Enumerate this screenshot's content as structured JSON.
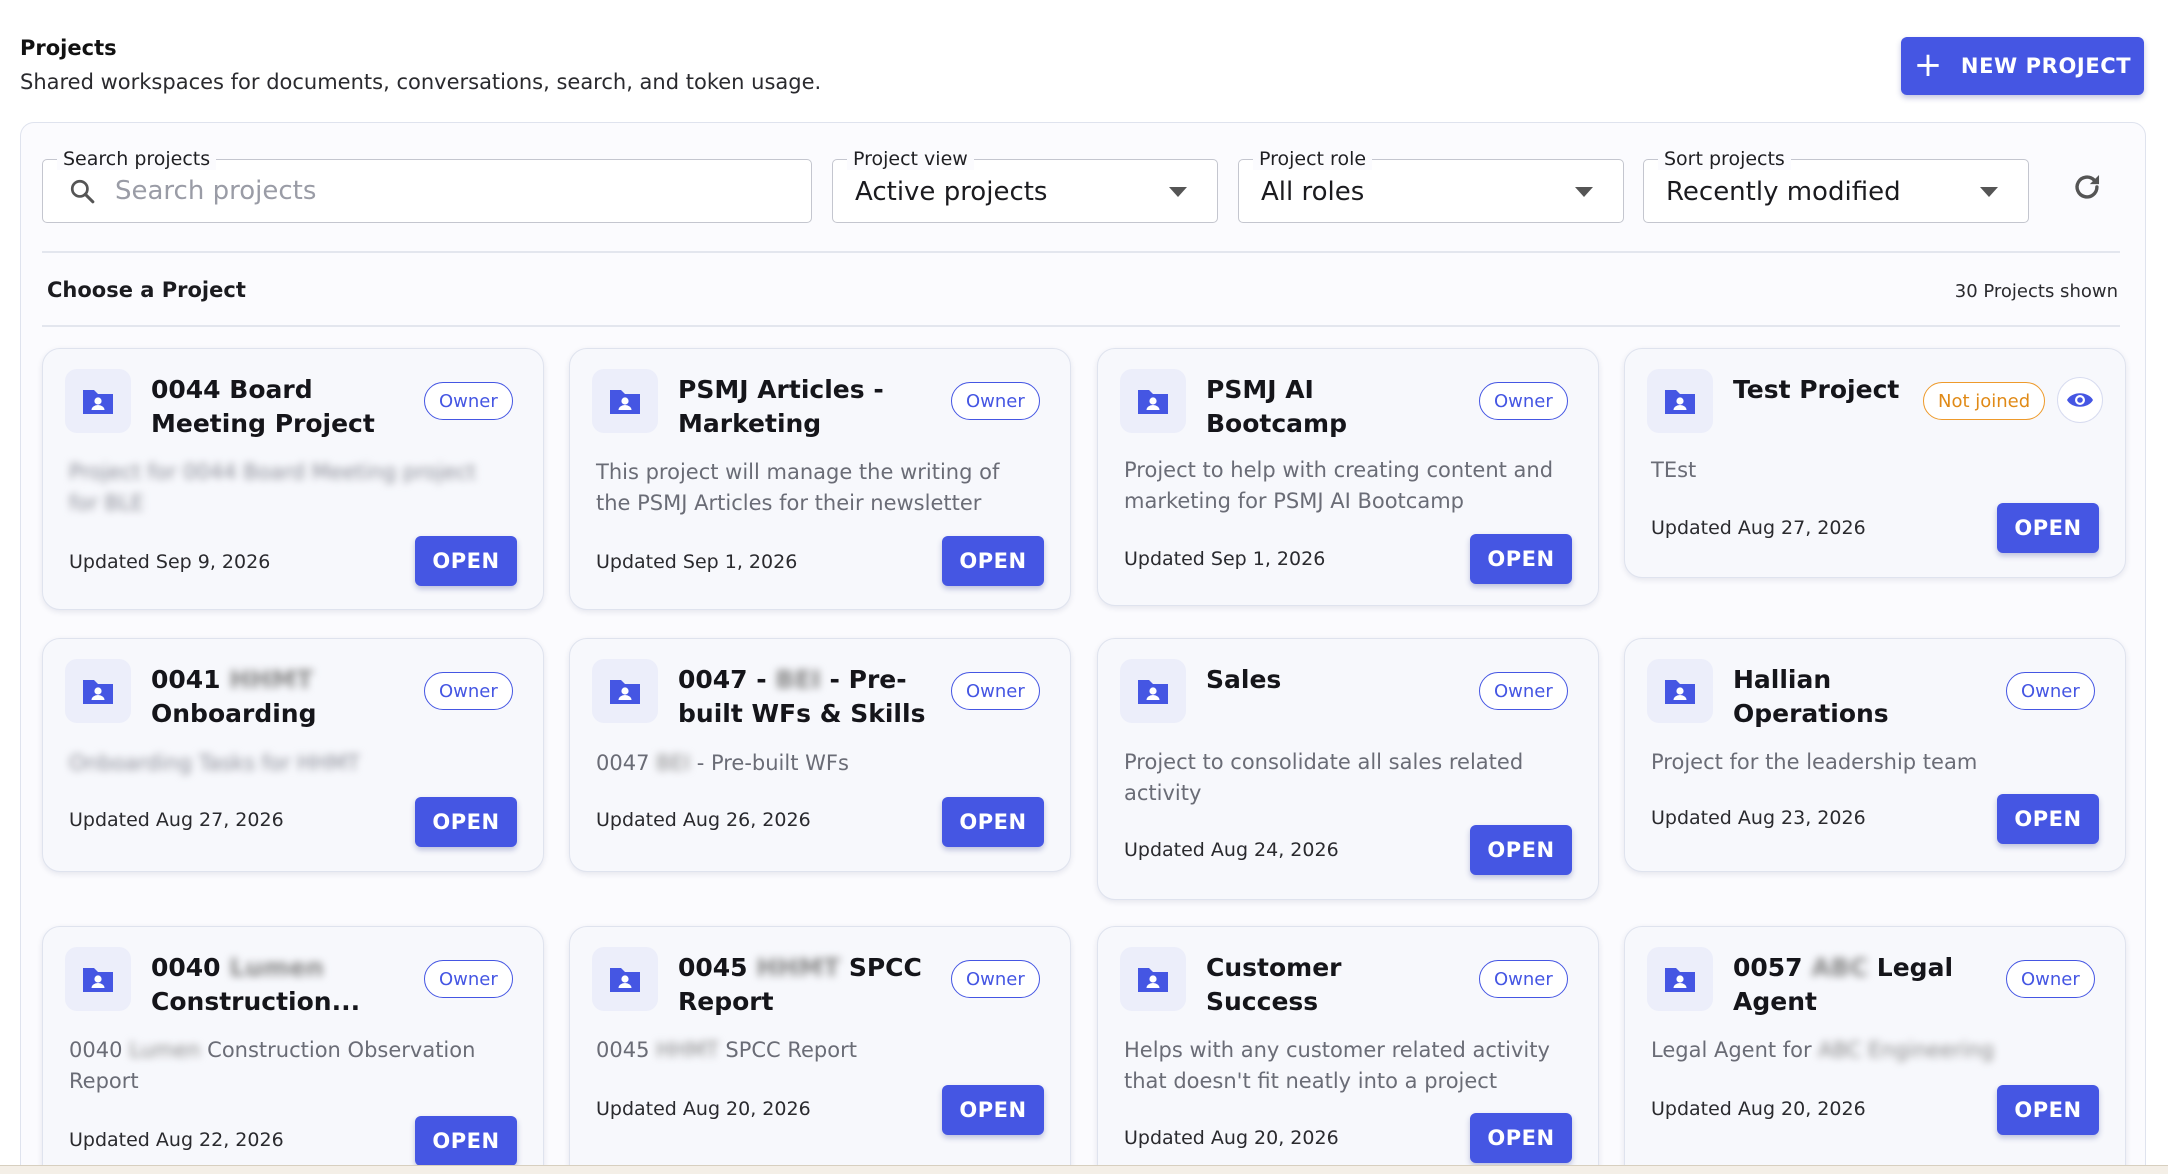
{
  "header": {
    "title": "Projects",
    "subtitle": "Shared workspaces for documents, conversations, search, and token usage.",
    "new_project_label": "NEW PROJECT"
  },
  "filters": {
    "search": {
      "label": "Search projects",
      "placeholder": "Search projects",
      "value": ""
    },
    "view": {
      "label": "Project view",
      "value": "Active projects"
    },
    "role": {
      "label": "Project role",
      "value": "All roles"
    },
    "sort": {
      "label": "Sort projects",
      "value": "Recently modified"
    }
  },
  "section": {
    "title": "Choose a Project",
    "count": "30 Projects shown"
  },
  "icons": {
    "project": "folder-person-icon",
    "search": "search-icon",
    "refresh": "refresh-icon",
    "add": "plus-icon",
    "view": "eye-icon"
  },
  "colors": {
    "accent": "#4556e3",
    "not_joined": "#e08a17"
  },
  "cards": [
    {
      "title": "0044 Board Meeting Project",
      "badge": "Owner",
      "description": "Project for 0044 Board Meeting project for BLE",
      "updated": "Updated Sep 9, 2026",
      "open": "OPEN"
    },
    {
      "title": "PSMJ Articles - Marketing",
      "badge": "Owner",
      "description": "This project will manage the writing of the PSMJ Articles for their newsletter",
      "updated": "Updated Sep 1, 2026",
      "open": "OPEN"
    },
    {
      "title": "PSMJ AI Bootcamp",
      "badge": "Owner",
      "description": "Project to help with creating content and marketing for PSMJ AI Bootcamp",
      "updated": "Updated Sep 1, 2026",
      "open": "OPEN"
    },
    {
      "title": "Test Project",
      "badge": "Not joined",
      "description": "TEst",
      "updated": "Updated Aug 27, 2026",
      "open": "OPEN"
    },
    {
      "title_prefix": "0041",
      "title_blur": "HHMT",
      "title_suffix": "Onboarding",
      "badge": "Owner",
      "description": "Onboarding Tasks for HHMT",
      "updated": "Updated Aug 27, 2026",
      "open": "OPEN"
    },
    {
      "title_prefix": "0047 -",
      "title_blur": "BEI",
      "title_suffix": "- Pre-built WFs & Skills",
      "badge": "Owner",
      "desc_prefix": "0047",
      "desc_blur": "BEI",
      "desc_suffix": "- Pre-built WFs",
      "updated": "Updated Aug 26, 2026",
      "open": "OPEN"
    },
    {
      "title": "Sales",
      "badge": "Owner",
      "description": "Project to consolidate all sales related activity",
      "updated": "Updated Aug 24, 2026",
      "open": "OPEN"
    },
    {
      "title": "Hallian Operations",
      "badge": "Owner",
      "description": "Project for the leadership team",
      "updated": "Updated Aug 23, 2026",
      "open": "OPEN"
    },
    {
      "title_prefix": "0040",
      "title_blur": "Lumen",
      "title_suffix": "Construction...",
      "badge": "Owner",
      "desc_prefix": "0040",
      "desc_blur": "Lumen",
      "desc_suffix": "Construction Observation Report",
      "updated": "Updated Aug 22, 2026",
      "open": "OPEN"
    },
    {
      "title_prefix": "0045",
      "title_blur": "HHMT",
      "title_suffix": "SPCC Report",
      "badge": "Owner",
      "desc_prefix": "0045",
      "desc_blur": "HHMT",
      "desc_suffix": "SPCC Report",
      "updated": "Updated Aug 20, 2026",
      "open": "OPEN"
    },
    {
      "title": "Customer Success",
      "badge": "Owner",
      "description": "Helps with any customer related activity that doesn't fit neatly into a project",
      "updated": "Updated Aug 20, 2026",
      "open": "OPEN"
    },
    {
      "title_prefix": "0057",
      "title_blur": "ABC",
      "title_suffix": "Legal Agent",
      "badge": "Owner",
      "desc_prefix": "Legal Agent for",
      "desc_blur": "ABC Engineering",
      "desc_suffix": "",
      "updated": "Updated Aug 20, 2026",
      "open": "OPEN"
    }
  ]
}
